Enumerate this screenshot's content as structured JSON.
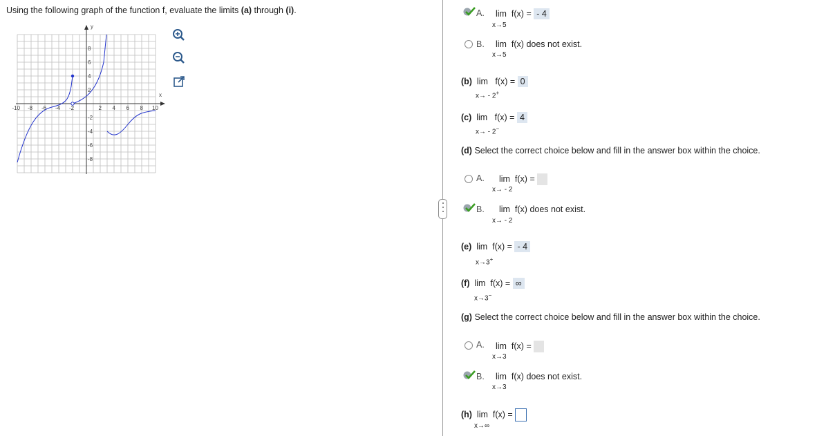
{
  "instructions": {
    "pre": "Using the following graph of the function f, evaluate the limits ",
    "a": "(a)",
    "mid": " through ",
    "i": "(i)",
    "post": "."
  },
  "graph": {
    "x_axis_label": "x",
    "y_axis_label": "y",
    "x_tick_labels": [
      "-10",
      "-8",
      "-6",
      "-4",
      "-2",
      "2",
      "4",
      "6",
      "8",
      "10"
    ],
    "y_tick_labels": [
      "8",
      "6",
      "4",
      "2",
      "-2",
      "-4",
      "-6",
      "-8"
    ],
    "curve_color": "#2233cc"
  },
  "tools": {
    "zoom_in": "zoom-in-icon",
    "zoom_out": "zoom-out-icon",
    "popout": "popout-icon"
  },
  "part_a": {
    "optA": {
      "letter": "A.",
      "lim": "lim",
      "fx": "f(x) =",
      "sub": "x→5",
      "answer": "- 4"
    },
    "optB": {
      "letter": "B.",
      "lim": "lim",
      "text": "f(x) does not exist.",
      "sub": "x→5"
    }
  },
  "part_b": {
    "label": "(b)",
    "lim": "lim",
    "fx": "f(x) =",
    "sub": "x→ - 2",
    "sup": "+",
    "answer": "0"
  },
  "part_c": {
    "label": "(c)",
    "lim": "lim",
    "fx": "f(x) =",
    "sub": "x→ - 2",
    "sup": "−",
    "answer": "4"
  },
  "part_d": {
    "prompt_label": "(d)",
    "prompt": " Select the correct choice below and fill in the answer box within the choice.",
    "optA": {
      "letter": "A.",
      "lim": "lim",
      "fx": "f(x) =",
      "sub": "x→ - 2"
    },
    "optB": {
      "letter": "B.",
      "lim": "lim",
      "text": "f(x) does not exist.",
      "sub": "x→ - 2"
    }
  },
  "part_e": {
    "label": "(e)",
    "lim": "lim",
    "fx": "f(x) =",
    "sub": "x→3",
    "sup": "+",
    "answer": "- 4"
  },
  "part_f": {
    "label": "(f)",
    "lim": "lim",
    "fx": "f(x) =",
    "sub": "x→3",
    "sup": "−",
    "answer": "∞"
  },
  "part_g": {
    "prompt_label": "(g)",
    "prompt": " Select the correct choice below and fill in the answer box within the choice.",
    "optA": {
      "letter": "A.",
      "lim": "lim",
      "fx": "f(x) =",
      "sub": "x→3"
    },
    "optB": {
      "letter": "B.",
      "lim": "lim",
      "text": "f(x) does not exist.",
      "sub": "x→3"
    }
  },
  "part_h": {
    "label": "(h)",
    "lim": "lim",
    "fx": "f(x) =",
    "sub": "x→∞"
  },
  "colors": {
    "check": "#3a9d23",
    "answer_bg": "#dde6f0",
    "input_border": "#3a6fb0"
  }
}
